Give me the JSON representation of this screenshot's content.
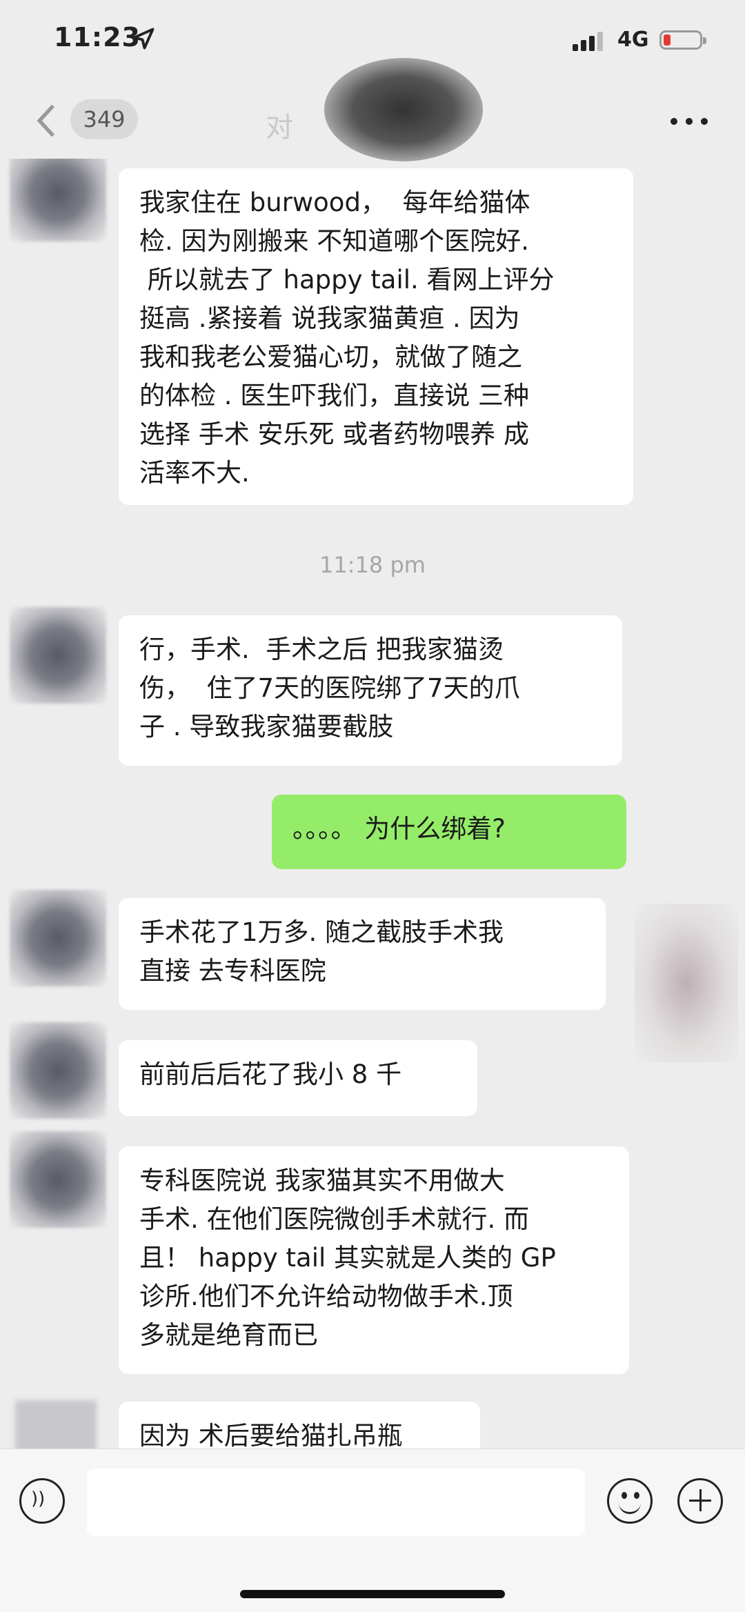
{
  "status_bar": {
    "time": "11:23",
    "network": "4G",
    "battery_level": 0.1
  },
  "nav": {
    "unread_count": "349",
    "title": "对"
  },
  "messages": [
    {
      "side": "left",
      "text": "我家住在 burwood，  每年给猫体\n检. 因为刚搬来 不知道哪个医院好.\n 所以就去了 happy tail. 看网上评分\n挺高 .紧接着 说我家猫黄疸 . 因为\n我和我老公爱猫心切，就做了随之\n的体检 . 医生吓我们，直接说 三种\n选择 手术 安乐死 或者药物喂养 成\n活率不大."
    },
    {
      "side": "left",
      "text": "行，手术.  手术之后 把我家猫烫\n伤，  住了7天的医院绑了7天的爪\n子 . 导致我家猫要截肢"
    },
    {
      "side": "right",
      "text": "。。。。 为什么绑着?"
    },
    {
      "side": "left",
      "text": "手术花了1万多. 随之截肢手术我\n直接 去专科医院"
    },
    {
      "side": "left",
      "text": "前前后后花了我小 8 千"
    },
    {
      "side": "left",
      "text": "专科医院说 我家猫其实不用做大\n手术. 在他们医院微创手术就行. 而\n且！ happy tail 其实就是人类的 GP\n诊所.他们不允许给动物做手术.顶\n多就是绝育而已"
    },
    {
      "side": "left",
      "text": "因为 术后要给猫扎吊瓶"
    }
  ],
  "timestamp": "11:18 pm",
  "colors": {
    "background": "#ededed",
    "bubble_left": "#ffffff",
    "bubble_right": "#95ec69",
    "battery_low": "#e53935"
  },
  "icons": [
    "location-arrow-icon",
    "signal-icon",
    "battery-icon",
    "back-chevron-icon",
    "more-dots-icon",
    "voice-icon",
    "emoji-icon",
    "plus-icon"
  ]
}
